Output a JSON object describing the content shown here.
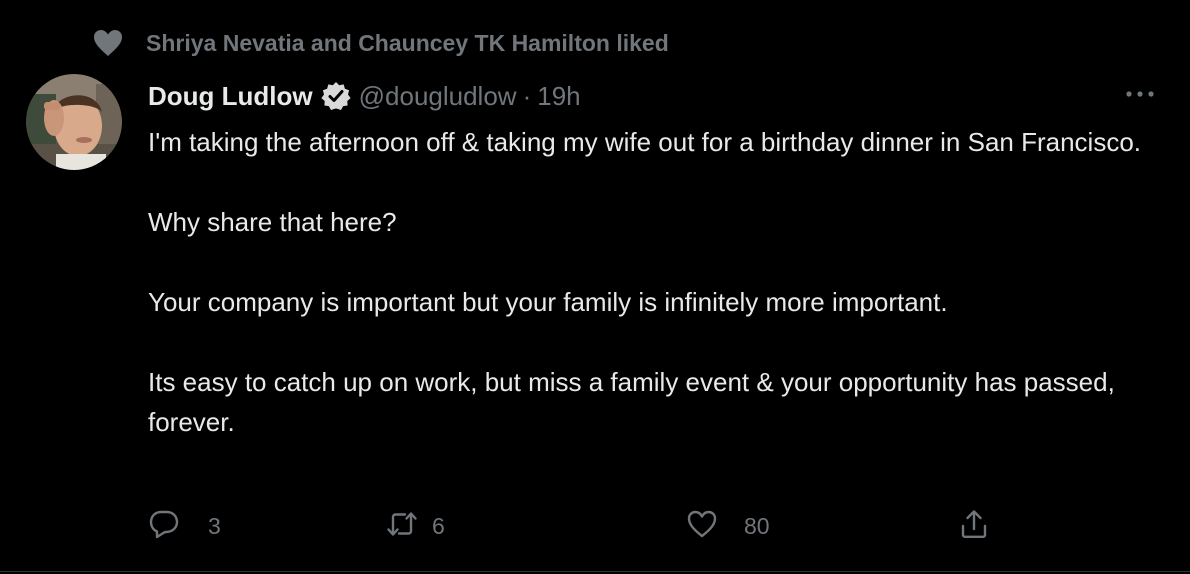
{
  "social_context": {
    "icon": "heart-icon",
    "text": "Shriya Nevatia and Chauncey TK Hamilton liked"
  },
  "author": {
    "name": "Doug Ludlow",
    "verified_icon": "verified-badge-icon",
    "handle": "@dougludlow",
    "separator": "·",
    "time": "19h"
  },
  "tweet": {
    "paragraphs": [
      "I'm taking the afternoon off & taking my wife out for a birthday dinner in San Francisco.",
      "Why share that here?",
      "Your company is important but your family is infinitely more important.",
      "Its easy to catch up on work, but miss a family event & your opportunity has passed, forever."
    ]
  },
  "actions": {
    "reply": {
      "icon": "reply-icon",
      "count": "3"
    },
    "retweet": {
      "icon": "retweet-icon",
      "count": "6"
    },
    "like": {
      "icon": "like-icon",
      "count": "80"
    },
    "share": {
      "icon": "share-icon"
    }
  },
  "colors": {
    "background": "#000000",
    "primary_text": "#e7e9ea",
    "secondary_text": "#71767b",
    "verified_badge": "#d9d9d9"
  }
}
